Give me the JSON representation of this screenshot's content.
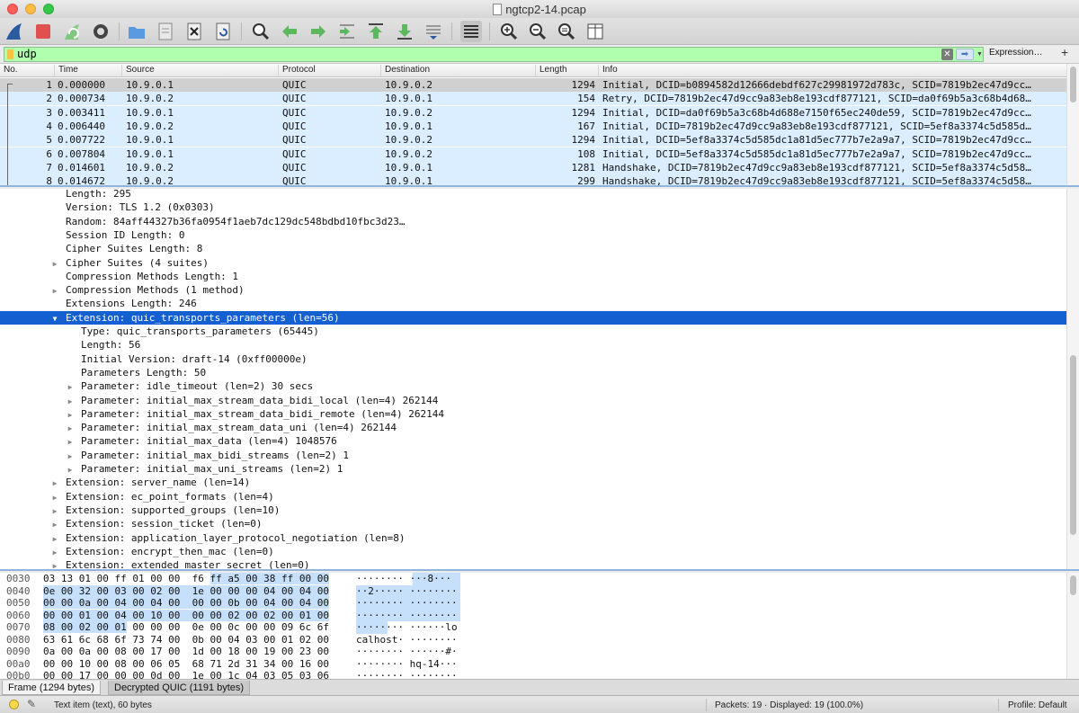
{
  "window": {
    "title": "ngtcp2-14.pcap"
  },
  "filter": {
    "value": "udp",
    "expression_label": "Expression…",
    "add_label": "+"
  },
  "packet_list": {
    "columns": [
      "No.",
      "Time",
      "Source",
      "Protocol",
      "Destination",
      "Length",
      "Info"
    ],
    "rows": [
      {
        "no": "1",
        "time": "0.000000",
        "src": "10.9.0.1",
        "proto": "QUIC",
        "dst": "10.9.0.2",
        "len": "1294",
        "info": "Initial, DCID=b0894582d12666debdf627c29981972d783c, SCID=7819b2ec47d9cc…"
      },
      {
        "no": "2",
        "time": "0.000734",
        "src": "10.9.0.2",
        "proto": "QUIC",
        "dst": "10.9.0.1",
        "len": "154",
        "info": "Retry, DCID=7819b2ec47d9cc9a83eb8e193cdf877121, SCID=da0f69b5a3c68b4d68…"
      },
      {
        "no": "3",
        "time": "0.003411",
        "src": "10.9.0.1",
        "proto": "QUIC",
        "dst": "10.9.0.2",
        "len": "1294",
        "info": "Initial, DCID=da0f69b5a3c68b4d688e7150f65ec240de59, SCID=7819b2ec47d9cc…"
      },
      {
        "no": "4",
        "time": "0.006440",
        "src": "10.9.0.2",
        "proto": "QUIC",
        "dst": "10.9.0.1",
        "len": "167",
        "info": "Initial, DCID=7819b2ec47d9cc9a83eb8e193cdf877121, SCID=5ef8a3374c5d585d…"
      },
      {
        "no": "5",
        "time": "0.007722",
        "src": "10.9.0.1",
        "proto": "QUIC",
        "dst": "10.9.0.2",
        "len": "1294",
        "info": "Initial, DCID=5ef8a3374c5d585dc1a81d5ec777b7e2a9a7, SCID=7819b2ec47d9cc…"
      },
      {
        "no": "6",
        "time": "0.007804",
        "src": "10.9.0.1",
        "proto": "QUIC",
        "dst": "10.9.0.2",
        "len": "108",
        "info": "Initial, DCID=5ef8a3374c5d585dc1a81d5ec777b7e2a9a7, SCID=7819b2ec47d9cc…"
      },
      {
        "no": "7",
        "time": "0.014601",
        "src": "10.9.0.2",
        "proto": "QUIC",
        "dst": "10.9.0.1",
        "len": "1281",
        "info": "Handshake, DCID=7819b2ec47d9cc9a83eb8e193cdf877121, SCID=5ef8a3374c5d58…"
      },
      {
        "no": "8",
        "time": "0.014672",
        "src": "10.9.0.2",
        "proto": "QUIC",
        "dst": "10.9.0.1",
        "len": "299",
        "info": "Handshake, DCID=7819b2ec47d9cc9a83eb8e193cdf877121, SCID=5ef8a3374c5d58…"
      }
    ]
  },
  "details": {
    "rows": [
      {
        "indent": 0,
        "expander": "",
        "text": "Length: 295"
      },
      {
        "indent": 0,
        "expander": "",
        "text": "Version: TLS 1.2 (0x0303)"
      },
      {
        "indent": 0,
        "expander": "",
        "text": "Random: 84aff44327b36fa0954f1aeb7dc129dc548bdbd10fbc3d23…"
      },
      {
        "indent": 0,
        "expander": "",
        "text": "Session ID Length: 0"
      },
      {
        "indent": 0,
        "expander": "",
        "text": "Cipher Suites Length: 8"
      },
      {
        "indent": 0,
        "expander": "collapsed",
        "text": "Cipher Suites (4 suites)"
      },
      {
        "indent": 0,
        "expander": "",
        "text": "Compression Methods Length: 1"
      },
      {
        "indent": 0,
        "expander": "collapsed",
        "text": "Compression Methods (1 method)"
      },
      {
        "indent": 0,
        "expander": "",
        "text": "Extensions Length: 246"
      },
      {
        "indent": 0,
        "expander": "expanded",
        "text": "Extension: quic_transports_parameters (len=56)",
        "selected": true
      },
      {
        "indent": 1,
        "expander": "",
        "text": "Type: quic_transports_parameters (65445)"
      },
      {
        "indent": 1,
        "expander": "",
        "text": "Length: 56"
      },
      {
        "indent": 1,
        "expander": "",
        "text": "Initial Version: draft-14 (0xff00000e)"
      },
      {
        "indent": 1,
        "expander": "",
        "text": "Parameters Length: 50"
      },
      {
        "indent": 1,
        "expander": "collapsed",
        "text": "Parameter: idle_timeout (len=2) 30 secs"
      },
      {
        "indent": 1,
        "expander": "collapsed",
        "text": "Parameter: initial_max_stream_data_bidi_local (len=4) 262144"
      },
      {
        "indent": 1,
        "expander": "collapsed",
        "text": "Parameter: initial_max_stream_data_bidi_remote (len=4) 262144"
      },
      {
        "indent": 1,
        "expander": "collapsed",
        "text": "Parameter: initial_max_stream_data_uni (len=4) 262144"
      },
      {
        "indent": 1,
        "expander": "collapsed",
        "text": "Parameter: initial_max_data (len=4) 1048576"
      },
      {
        "indent": 1,
        "expander": "collapsed",
        "text": "Parameter: initial_max_bidi_streams (len=2) 1"
      },
      {
        "indent": 1,
        "expander": "collapsed",
        "text": "Parameter: initial_max_uni_streams (len=2) 1"
      },
      {
        "indent": 0,
        "expander": "collapsed",
        "text": "Extension: server_name (len=14)"
      },
      {
        "indent": 0,
        "expander": "collapsed",
        "text": "Extension: ec_point_formats (len=4)"
      },
      {
        "indent": 0,
        "expander": "collapsed",
        "text": "Extension: supported_groups (len=10)"
      },
      {
        "indent": 0,
        "expander": "collapsed",
        "text": "Extension: session_ticket (len=0)"
      },
      {
        "indent": 0,
        "expander": "collapsed",
        "text": "Extension: application_layer_protocol_negotiation (len=8)"
      },
      {
        "indent": 0,
        "expander": "collapsed",
        "text": "Extension: encrypt_then_mac (len=0)"
      },
      {
        "indent": 0,
        "expander": "collapsed",
        "text": "Extension: extended_master_secret (len=0)"
      }
    ]
  },
  "bytes": {
    "rows": [
      {
        "offset": "0030",
        "hex": [
          "03",
          "13",
          "01",
          "00",
          "ff",
          "01",
          "00",
          "00",
          "f6",
          "ff",
          "a5",
          "00",
          "38",
          "ff",
          "00",
          "00"
        ],
        "hl_from": 9,
        "ascii": "········ ···8···",
        "ascii_hl_from": 9
      },
      {
        "offset": "0040",
        "hex": [
          "0e",
          "00",
          "32",
          "00",
          "03",
          "00",
          "02",
          "00",
          "1e",
          "00",
          "00",
          "00",
          "04",
          "00",
          "04",
          "00"
        ],
        "hl_from": 0,
        "ascii": "··2····· ········",
        "ascii_hl_from": 0
      },
      {
        "offset": "0050",
        "hex": [
          "00",
          "00",
          "0a",
          "00",
          "04",
          "00",
          "04",
          "00",
          "00",
          "00",
          "0b",
          "00",
          "04",
          "00",
          "04",
          "00"
        ],
        "hl_from": 0,
        "ascii": "········ ········",
        "ascii_hl_from": 0
      },
      {
        "offset": "0060",
        "hex": [
          "00",
          "00",
          "01",
          "00",
          "04",
          "00",
          "10",
          "00",
          "00",
          "00",
          "02",
          "00",
          "02",
          "00",
          "01",
          "00"
        ],
        "hl_from": 0,
        "ascii": "········ ········",
        "ascii_hl_from": 0
      },
      {
        "offset": "0070",
        "hex": [
          "08",
          "00",
          "02",
          "00",
          "01",
          "00",
          "00",
          "00",
          "0e",
          "00",
          "0c",
          "00",
          "00",
          "09",
          "6c",
          "6f"
        ],
        "hl_to": 5,
        "ascii": "········ ······lo",
        "ascii_hl_to": 5
      },
      {
        "offset": "0080",
        "hex": [
          "63",
          "61",
          "6c",
          "68",
          "6f",
          "73",
          "74",
          "00",
          "0b",
          "00",
          "04",
          "03",
          "00",
          "01",
          "02",
          "00"
        ],
        "ascii": "calhost· ········"
      },
      {
        "offset": "0090",
        "hex": [
          "0a",
          "00",
          "0a",
          "00",
          "08",
          "00",
          "17",
          "00",
          "1d",
          "00",
          "18",
          "00",
          "19",
          "00",
          "23",
          "00"
        ],
        "ascii": "········ ······#·"
      },
      {
        "offset": "00a0",
        "hex": [
          "00",
          "00",
          "10",
          "00",
          "08",
          "00",
          "06",
          "05",
          "68",
          "71",
          "2d",
          "31",
          "34",
          "00",
          "16",
          "00"
        ],
        "ascii": "········ hq-14···"
      },
      {
        "offset": "00b0",
        "hex": [
          "00",
          "00",
          "17",
          "00",
          "00",
          "00",
          "0d",
          "00",
          "1e",
          "00",
          "1c",
          "04",
          "03",
          "05",
          "03",
          "06"
        ],
        "ascii": "········ ········"
      }
    ]
  },
  "byte_tabs": [
    "Frame (1294 bytes)",
    "Decrypted QUIC (1191 bytes)"
  ],
  "status": {
    "text": "Text item (text), 60 bytes",
    "packets": "Packets: 19 · Displayed: 19 (100.0%)",
    "profile": "Profile: Default"
  },
  "colors": {
    "selected_detail": "#1560d0",
    "packet_row": "#daeeff",
    "filter_ok": "#afffaf"
  }
}
